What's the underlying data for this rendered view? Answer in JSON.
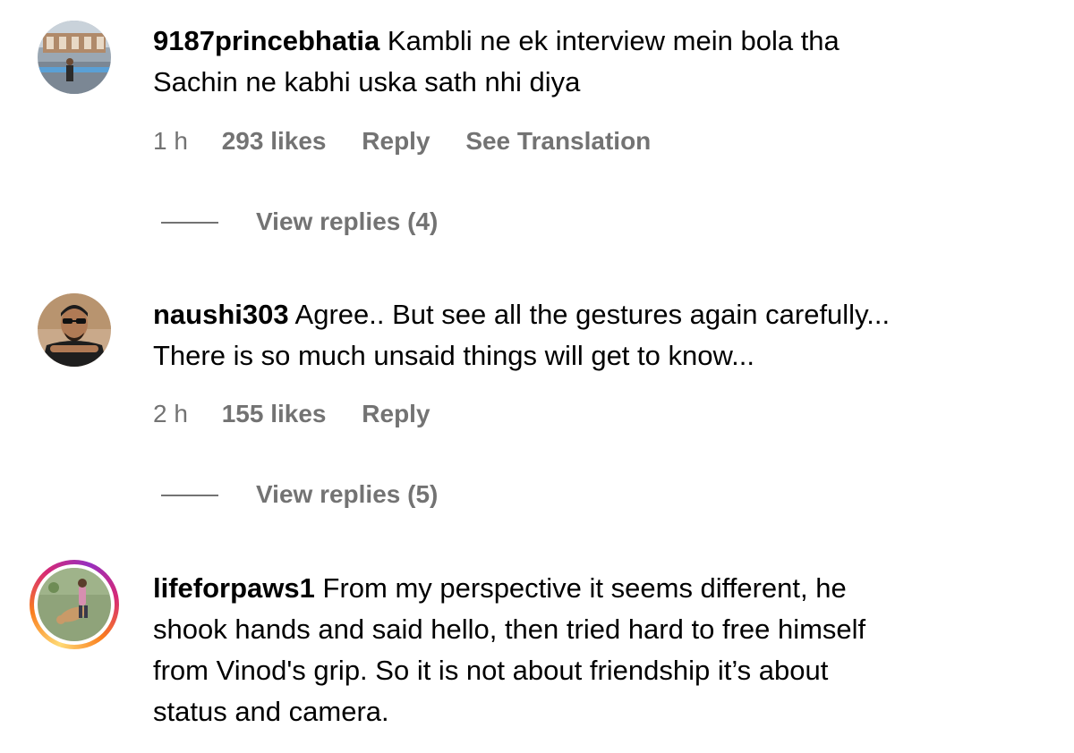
{
  "comments": [
    {
      "username": "9187princebhatia",
      "text_line1": "Kambli ne ek interview mein bola tha",
      "text_line2": "Sachin ne kabhi uska sath nhi diya",
      "time": "1 h",
      "likes": "293 likes",
      "reply": "Reply",
      "translate": "See Translation",
      "view_replies": "View replies (4)",
      "avatar_icon": "user-photo-avatar"
    },
    {
      "username": "naushi303",
      "text_line1": "Agree.. But see all the gestures again carefully...",
      "text_line2": "There is so much unsaid things will get to know...",
      "time": "2 h",
      "likes": "155 likes",
      "reply": "Reply",
      "view_replies": "View replies (5)",
      "avatar_icon": "user-photo-avatar"
    },
    {
      "username": "lifeforpaws1",
      "text_line1": "From my perspective it seems different, he",
      "text_line2": "shook hands and said hello, then tried hard to free himself",
      "text_line3": "from Vinod's grip. So it is not about friendship it’s about",
      "text_line4": "status and camera.",
      "avatar_icon": "story-ring-avatar"
    }
  ],
  "colors": {
    "secondary_text": "#737373",
    "primary_text": "#000000",
    "story_ring": "#d62976"
  }
}
